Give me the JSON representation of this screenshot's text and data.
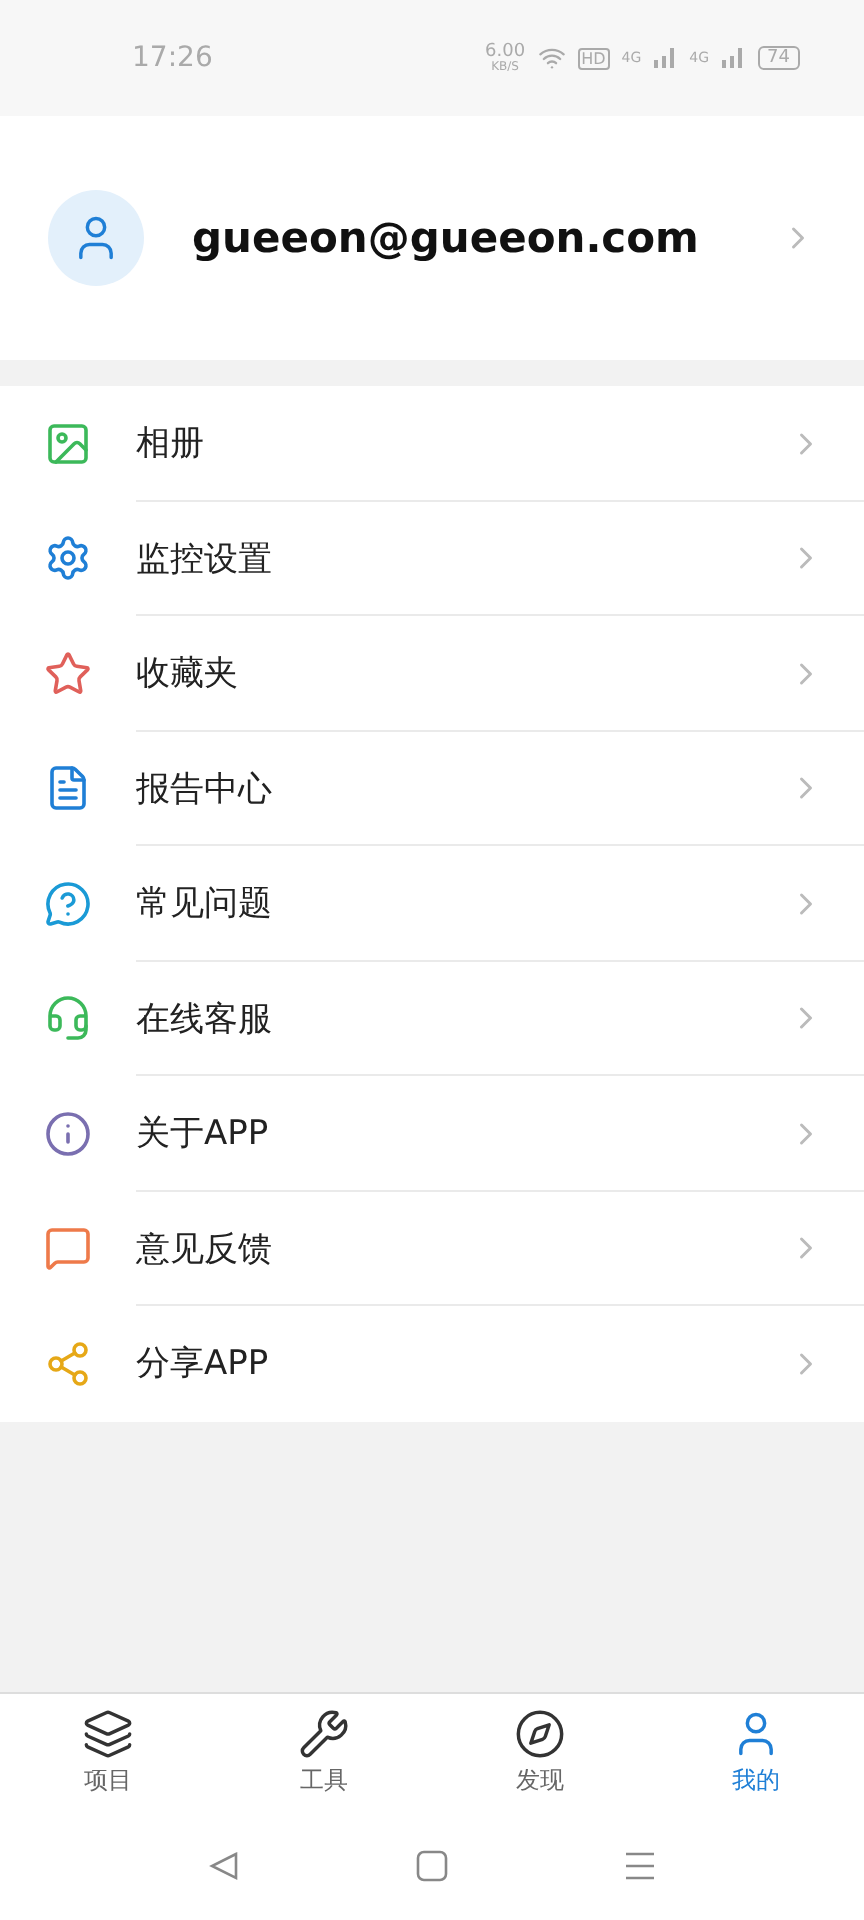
{
  "status_bar": {
    "time": "17:26",
    "speed": "6.00",
    "speed_unit": "KB/S",
    "hd": "HD",
    "network_1": "4G",
    "network_2": "4G",
    "battery": "74"
  },
  "profile": {
    "email": "gueeon@gueeon.com"
  },
  "menu": [
    {
      "kind": "album",
      "label": "相册",
      "color": "#3cb95a"
    },
    {
      "kind": "settings",
      "label": "监控设置",
      "color": "#1f7fd6"
    },
    {
      "kind": "star",
      "label": "收藏夹",
      "color": "#e0605a"
    },
    {
      "kind": "report",
      "label": "报告中心",
      "color": "#1f7fd6"
    },
    {
      "kind": "faq",
      "label": "常见问题",
      "color": "#1a9ad6"
    },
    {
      "kind": "support",
      "label": "在线客服",
      "color": "#3cb95a"
    },
    {
      "kind": "about",
      "label": "关于APP",
      "color": "#7a6fb0"
    },
    {
      "kind": "feedback",
      "label": "意见反馈",
      "color": "#ee7a4a"
    },
    {
      "kind": "share",
      "label": "分享APP",
      "color": "#e6a817"
    }
  ],
  "tabs": [
    {
      "kind": "layers",
      "label": "项目",
      "selected": false
    },
    {
      "kind": "wrench",
      "label": "工具",
      "selected": false
    },
    {
      "kind": "compass",
      "label": "发现",
      "selected": false
    },
    {
      "kind": "user",
      "label": "我的",
      "selected": true
    }
  ]
}
